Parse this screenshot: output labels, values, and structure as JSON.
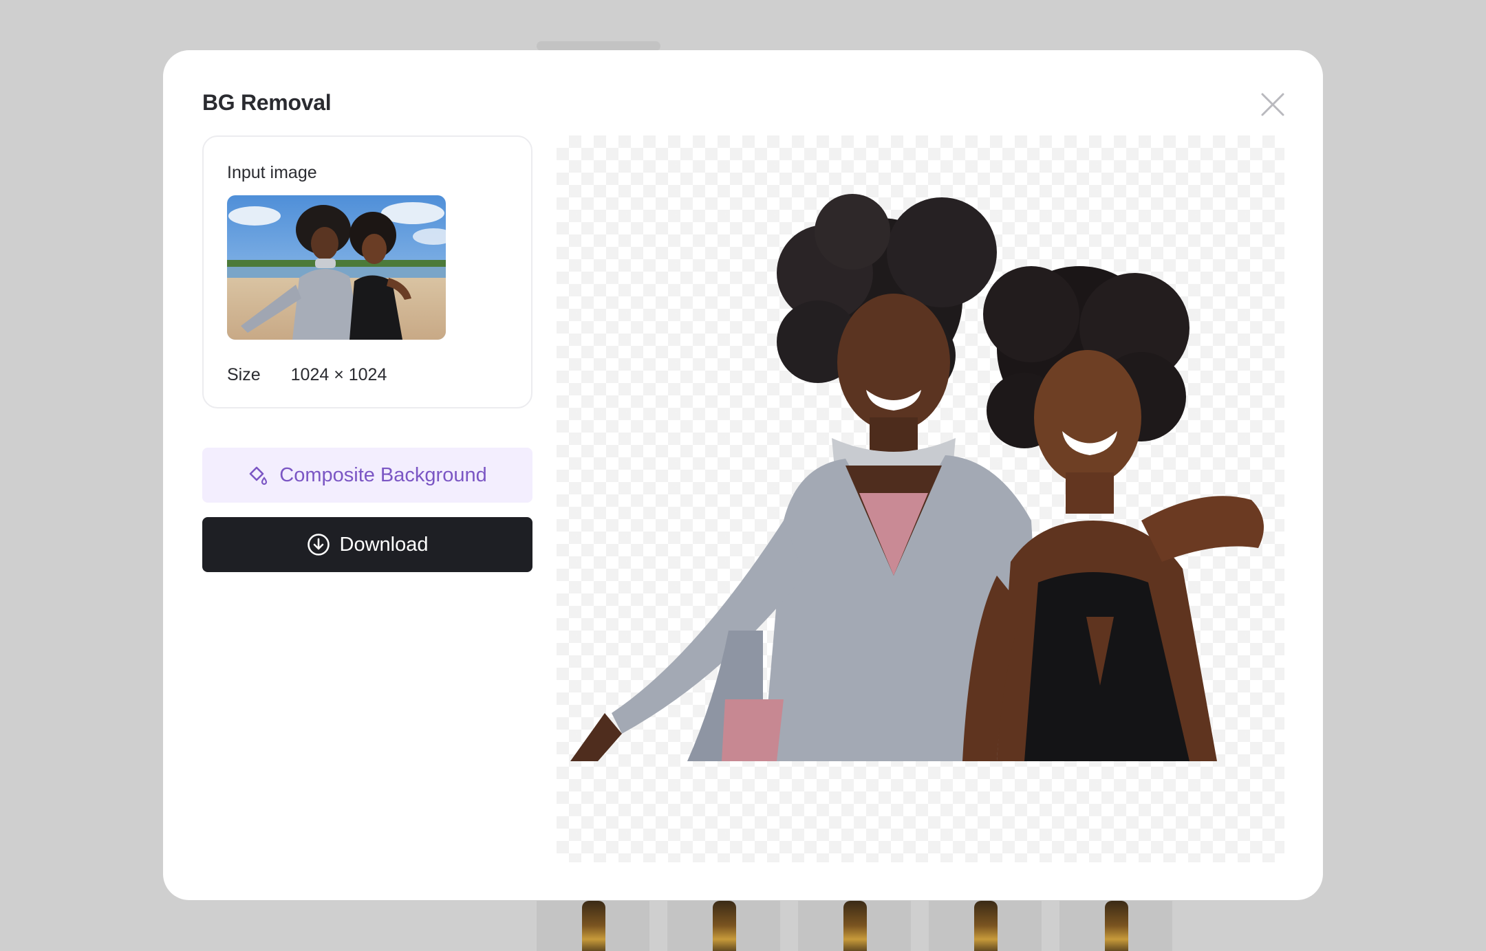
{
  "modal": {
    "title": "BG Removal"
  },
  "input_card": {
    "label": "Input image",
    "size_label": "Size",
    "size_value": "1024 × 1024"
  },
  "actions": {
    "composite_label": "Composite Background",
    "download_label": "Download"
  },
  "icons": {
    "close": "close-icon",
    "composite": "paint-fill-icon",
    "download": "download-circle-icon"
  },
  "colors": {
    "accent_purple": "#7b56c4",
    "accent_purple_bg": "#f3eefe",
    "download_bg": "#1e1f24",
    "overlay": "#cfcfcf"
  }
}
